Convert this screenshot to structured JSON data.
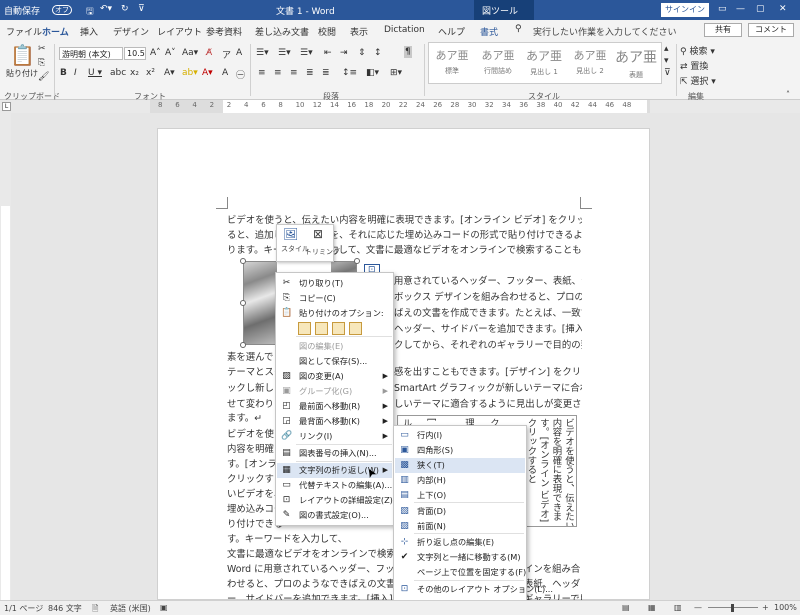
{
  "titlebar": {
    "autosave_label": "自動保存",
    "autosave_state": "オフ",
    "doc_title": "文書 1 - Word",
    "context_tab": "図ツール",
    "signin": "サインイン"
  },
  "tabs": [
    "ファイル",
    "ホーム",
    "挿入",
    "デザイン",
    "レイアウト",
    "参考資料",
    "差し込み文書",
    "校閲",
    "表示",
    "Dictation",
    "ヘルプ",
    "書式"
  ],
  "tellme": "実行したい作業を入力してください",
  "share": "共有",
  "comment": "コメント",
  "ribbon": {
    "paste_label": "貼り付け",
    "clipboard_group": "クリップボード",
    "font_name": "游明朝 (本文)",
    "font_size": "10.5",
    "font_group": "フォント",
    "paragraph_group": "段落",
    "styles_group": "スタイル",
    "edit_group": "編集",
    "styles": [
      {
        "sample": "あア亜",
        "name": "標準"
      },
      {
        "sample": "あア亜",
        "name": "行間詰め"
      },
      {
        "sample": "あア亜",
        "name": "見出し 1"
      },
      {
        "sample": "あア亜",
        "name": "見出し 2"
      },
      {
        "sample": "あア亜",
        "name": "表題"
      }
    ],
    "find": "検索",
    "replace": "置換",
    "select": "選択"
  },
  "ruler_numbers": [
    "8",
    "6",
    "4",
    "2",
    "2",
    "4",
    "6",
    "8",
    "10",
    "12",
    "14",
    "16",
    "18",
    "20",
    "22",
    "24",
    "26",
    "28",
    "30",
    "32",
    "34",
    "36",
    "38",
    "40",
    "42",
    "44",
    "46",
    "48"
  ],
  "document": {
    "lines_top": [
      "ビデオを使うと、伝えたい内容を明確に表現できます。[オンライン ビデオ] をクリックす",
      "ると、追加したいビデオを、それに応じた埋め込みコードの形式で貼り付けできるようにな",
      "ります。キーワードを入力して、文書に最適なビデオをオンラインで検索することもできま"
    ],
    "lines_right": [
      "用意されているヘッダー、フッター、表紙、テ",
      "ボックス デザインを組み合わせると、プロのよ",
      "ばえの文書を作成できます。たとえば、一致す",
      "ヘッダー、サイドバーを追加できます。[挿入]",
      "クしてから、それぞれのギャラリーで目的の要"
    ],
    "line_full_1": "素を選んでください。",
    "lines_mid_right": [
      "感を出すこともできます。[デザイン] をクリ",
      "SmartArt グラフィックが新しいテーマに合わ",
      "しいテーマに適合するように見出しが変更され"
    ],
    "lines_left": [
      "テーマとスタ",
      "ックし新しい",
      "せて変わりま",
      "ます。↵",
      "ビデオを使う",
      "内容を明確に",
      "す。[オンライ",
      "クリックする",
      "いビデオを、",
      "埋め込みコー",
      "り付けできる"
    ],
    "line_keyword": "す。キーワードを入力して、",
    "lines_bottom": [
      "文書に最適なビデオをオンラインで検索す",
      "Word に用意されているヘッダー、フッタ",
      "わせると、プロのようなできばえの文書を",
      "ー、サイドバーを追加できます。[挿入] を"
    ],
    "lines_bottom_right": [
      "インを組み合",
      "表紙、ヘッダ",
      "ギャラリーで目"
    ],
    "vertical_cols": [
      "ビデオを使うと、伝えたい",
      "内容を明確に表現できま",
      "す。[オンライン ビデオ]",
      "クリックすると",
      "",
      "",
      "ク",
      "",
      "理",
      "",
      "",
      "[",
      "",
      "ル"
    ]
  },
  "minitoolbar": {
    "style": "スタイル",
    "crop": "トリミング"
  },
  "context_menu": {
    "items": [
      {
        "label": "切り取り(T)",
        "icon": "scissors-icon",
        "disabled": false
      },
      {
        "label": "コピー(C)",
        "icon": "copy-icon",
        "disabled": false
      },
      {
        "label": "貼り付けのオプション:",
        "icon": "paste-icon",
        "disabled": false
      },
      {
        "label": "図の編集(E)",
        "icon": "",
        "disabled": true
      },
      {
        "label": "図として保存(S)...",
        "icon": "",
        "disabled": false
      },
      {
        "label": "図の変更(A)",
        "icon": "change-picture-icon",
        "disabled": false,
        "submenu": true
      },
      {
        "label": "グループ化(G)",
        "icon": "group-icon",
        "disabled": true,
        "submenu": true
      },
      {
        "label": "最前面へ移動(R)",
        "icon": "bring-front-icon",
        "disabled": false,
        "submenu": true
      },
      {
        "label": "最背面へ移動(K)",
        "icon": "send-back-icon",
        "disabled": false,
        "submenu": true
      },
      {
        "label": "リンク(I)",
        "icon": "link-icon",
        "disabled": false,
        "submenu": true
      },
      {
        "label": "図表番号の挿入(N)...",
        "icon": "caption-icon",
        "disabled": false
      },
      {
        "label": "文字列の折り返し(W)",
        "icon": "wrap-text-icon",
        "disabled": false,
        "submenu": true,
        "highlight": true
      },
      {
        "label": "代替テキストの編集(A)...",
        "icon": "alt-text-icon",
        "disabled": false
      },
      {
        "label": "レイアウトの詳細設定(Z)...",
        "icon": "layout-options-icon",
        "disabled": false
      },
      {
        "label": "図の書式設定(O)...",
        "icon": "format-picture-icon",
        "disabled": false
      }
    ]
  },
  "submenu": {
    "items": [
      {
        "label": "行内(I)",
        "icon": "inline-icon"
      },
      {
        "label": "四角形(S)",
        "icon": "square-icon"
      },
      {
        "label": "狭く(T)",
        "icon": "tight-icon",
        "highlight": true
      },
      {
        "label": "内部(H)",
        "icon": "through-icon"
      },
      {
        "label": "上下(O)",
        "icon": "top-bottom-icon"
      },
      {
        "label": "背面(D)",
        "icon": "behind-icon"
      },
      {
        "label": "前面(N)",
        "icon": "front-icon"
      },
      {
        "label": "折り返し点の編集(E)",
        "icon": "edit-wrap-icon"
      },
      {
        "label": "文字列と一緒に移動する(M)",
        "icon": "check-icon"
      },
      {
        "label": "ページ上で位置を固定する(F)",
        "icon": ""
      },
      {
        "label": "その他のレイアウト オプション(L)...",
        "icon": "more-layout-icon"
      },
      {
        "label": "既定のレイアウトとして設定(A)",
        "icon": ""
      }
    ]
  },
  "statusbar": {
    "page": "1/1 ページ",
    "words": "846 文字",
    "language": "英語 (米国)",
    "zoom": "100%"
  }
}
